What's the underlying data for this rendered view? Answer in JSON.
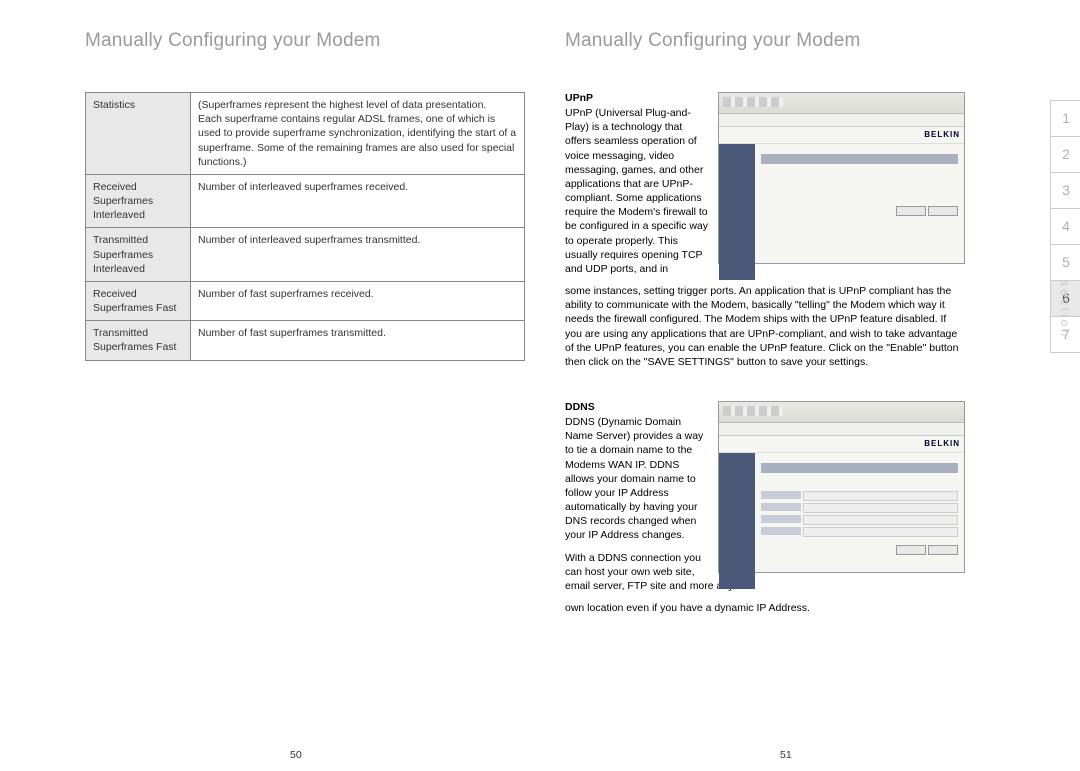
{
  "header_left": "Manually Configuring your Modem",
  "header_right": "Manually Configuring your Modem",
  "table": {
    "rows": [
      {
        "label": "Statistics",
        "desc": "(Superframes represent the highest level of data presentation.\nEach superframe contains regular ADSL frames, one of which is used to provide superframe synchronization, identifying the start of a superframe. Some of the remaining frames are also used for special functions.)"
      },
      {
        "label": "Received Superframes Interleaved",
        "desc": "Number of interleaved superframes received."
      },
      {
        "label": "Transmitted Superframes Interleaved",
        "desc": "Number of interleaved superframes transmitted."
      },
      {
        "label": "Received Superframes Fast",
        "desc": "Number of fast superframes received."
      },
      {
        "label": "Transmitted Superframes Fast",
        "desc": "Number of fast superframes transmitted."
      }
    ]
  },
  "upnp": {
    "heading": "UPnP",
    "p1": "UPnP (Universal Plug-and-Play) is a technology that offers seamless operation of voice messaging, video messaging, games, and other applications that are UPnP-compliant. Some applications require the Modem's firewall to be configured in a specific way to operate properly. This usually requires opening TCP and UDP ports, and in",
    "p2": "some instances, setting trigger ports. An application that is UPnP compliant has the ability to communicate with the Modem, basically \"telling\" the Modem which way it needs the firewall configured. The Modem ships with the UPnP feature disabled. If you are using any applications that are UPnP-compliant, and wish to take advantage of the UPnP features, you can enable the UPnP feature. Click on the \"Enable\" button then click on the \"SAVE SETTINGS\" button to save your settings."
  },
  "ddns": {
    "heading": "DDNS",
    "p1": "DDNS (Dynamic Domain Name Server) provides a way to tie a domain name to the Modems WAN IP. DDNS allows your domain name to follow your IP Address automatically by having your DNS records changed when your IP Address changes.",
    "p2": "With a DDNS connection you can host your own web site, email server, FTP site and more at your",
    "p3": "own location even if you have a dynamic IP Address."
  },
  "thumb_logo": "BELKIN",
  "page_left": "50",
  "page_right": "51",
  "tabs": [
    "1",
    "2",
    "3",
    "4",
    "5",
    "6",
    "7"
  ],
  "active_tab": "6",
  "section_label": "section"
}
